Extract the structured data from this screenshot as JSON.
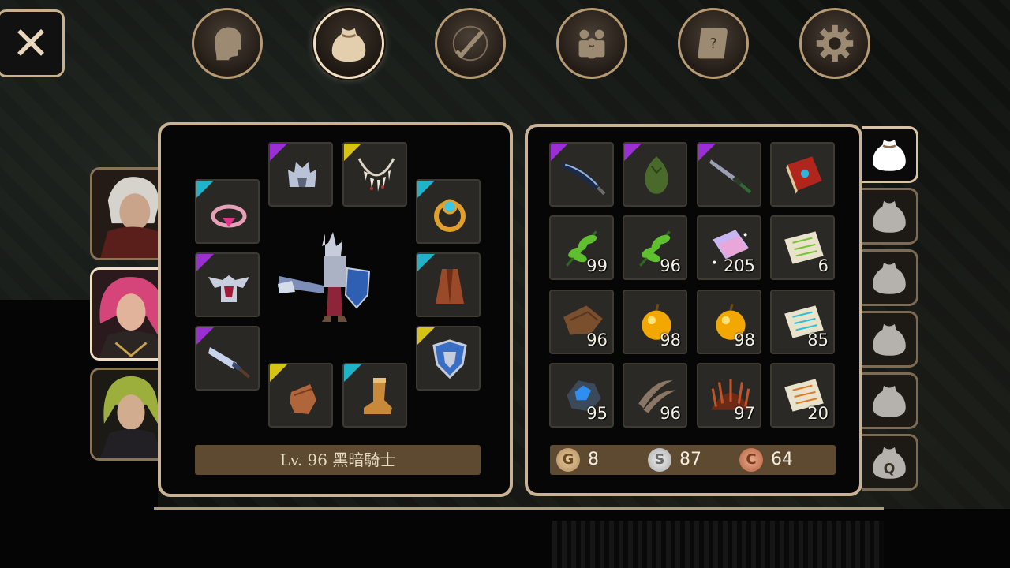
{
  "close_label": "✕",
  "top_tabs": [
    {
      "name": "tab-character",
      "icon": "head-icon",
      "active": false
    },
    {
      "name": "tab-inventory",
      "icon": "bag-icon",
      "active": true
    },
    {
      "name": "tab-skills",
      "icon": "sword-compass-icon",
      "active": false
    },
    {
      "name": "tab-party",
      "icon": "party-icon",
      "active": false
    },
    {
      "name": "tab-quests",
      "icon": "scroll-icon",
      "active": false
    },
    {
      "name": "tab-settings",
      "icon": "gear-icon",
      "active": false
    }
  ],
  "portraits": [
    {
      "name": "portrait-white-hair",
      "active": false
    },
    {
      "name": "portrait-pink-hair",
      "active": true
    },
    {
      "name": "portrait-green-hair",
      "active": false
    }
  ],
  "equipment": [
    {
      "name": "slot-helmet",
      "icon": "helmet-icon",
      "rarity": "purple"
    },
    {
      "name": "slot-necklace",
      "icon": "fang-necklace-icon",
      "rarity": "yellow"
    },
    {
      "name": "slot-ring-left",
      "icon": "pink-ring-icon",
      "rarity": "cyan"
    },
    {
      "name": "slot-ring-right",
      "icon": "gold-ring-icon",
      "rarity": "cyan"
    },
    {
      "name": "slot-armor",
      "icon": "winged-armor-icon",
      "rarity": "purple"
    },
    {
      "name": "slot-cloak",
      "icon": "cloak-icon",
      "rarity": "cyan"
    },
    {
      "name": "slot-weapon",
      "icon": "greatsword-icon",
      "rarity": "purple"
    },
    {
      "name": "slot-shield",
      "icon": "shield-icon",
      "rarity": "yellow"
    },
    {
      "name": "slot-gloves",
      "icon": "gloves-icon",
      "rarity": "yellow"
    },
    {
      "name": "slot-boots",
      "icon": "boots-icon",
      "rarity": "cyan"
    }
  ],
  "level_text": "Lv. 96 黑暗騎士",
  "inventory": [
    {
      "icon": "dark-blade-icon",
      "qty": "",
      "rare": true
    },
    {
      "icon": "green-egg-icon",
      "qty": "",
      "rare": true
    },
    {
      "icon": "dagger-icon",
      "qty": "",
      "rare": true
    },
    {
      "icon": "red-book-icon",
      "qty": "",
      "rare": false
    },
    {
      "icon": "herb-icon",
      "qty": "99",
      "rare": false
    },
    {
      "icon": "herb-icon",
      "qty": "96",
      "rare": false
    },
    {
      "icon": "crystal-cloth-icon",
      "qty": "205",
      "rare": false
    },
    {
      "icon": "scroll-green-icon",
      "qty": "6",
      "rare": false
    },
    {
      "icon": "leather-icon",
      "qty": "96",
      "rare": false
    },
    {
      "icon": "golden-apple-icon",
      "qty": "98",
      "rare": false
    },
    {
      "icon": "golden-apple-icon",
      "qty": "98",
      "rare": false
    },
    {
      "icon": "scroll-cyan-icon",
      "qty": "85",
      "rare": false
    },
    {
      "icon": "blue-ore-icon",
      "qty": "95",
      "rare": false
    },
    {
      "icon": "claw-icon",
      "qty": "96",
      "rare": false
    },
    {
      "icon": "spiky-shell-icon",
      "qty": "97",
      "rare": false
    },
    {
      "icon": "scroll-orange-icon",
      "qty": "20",
      "rare": false
    }
  ],
  "currency": {
    "gold_letter": "G",
    "gold": "8",
    "silver_letter": "S",
    "silver": "87",
    "copper_letter": "C",
    "copper": "64"
  },
  "bag_tabs": [
    {
      "label": "",
      "active": true
    },
    {
      "label": "",
      "active": false
    },
    {
      "label": "",
      "active": false
    },
    {
      "label": "",
      "active": false
    },
    {
      "label": "",
      "active": false
    },
    {
      "label": "Q",
      "active": false
    }
  ]
}
